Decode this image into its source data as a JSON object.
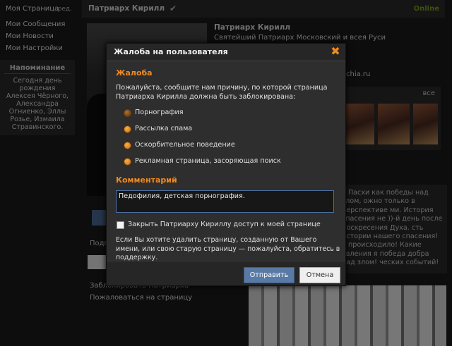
{
  "sidebar": {
    "items": [
      {
        "label": "Моя Страница",
        "edit": "ред."
      },
      {
        "label": "Мои Сообщения"
      },
      {
        "label": "Мои Новости"
      },
      {
        "label": "Мои Настройки"
      }
    ],
    "reminder": {
      "title": "Напоминание",
      "text": "Сегодня день рождения Алексея Чёрного, Александра Огниенко, Эллы Розье, Измаила Стравинского."
    }
  },
  "header": {
    "name": "Патриарх Кирилл",
    "status": "Online"
  },
  "profile": {
    "name": "Патриарх Кирилл",
    "title": "Святейший Патриарх Московский и всея Руси",
    "site_fragment": "chia.ru",
    "photos_all": "все",
    "post_text": "е Пасхи как победы над злом, ожно только в перспективе ми. История спасения не ))-й день после Воскресения Духа. сть истории нашего спасения! е происходило! Какие явления я победа добра над злом! ческих событий!",
    "under_text": "Подп",
    "link_block": "Заблокировать Патриарха",
    "link_report": "Пожаловаться на страницу"
  },
  "modal": {
    "title": "Жалоба на пользователя",
    "section_reason": "Жалоба",
    "prompt": "Пожалуйста, сообщите нам причину, по которой страница Патриарха Кирилла должна быть заблокирована:",
    "options": [
      "Порнография",
      "Рассылка спама",
      "Оскорбительное поведение",
      "Рекламная страница, засоряющая поиск"
    ],
    "selected_option": 0,
    "section_comment": "Комментарий",
    "comment_value": "Педофилия, детская порнография.",
    "checkbox_label": "Закрыть Патриарху Кириллу доступ к моей странице",
    "checkbox_checked": false,
    "note": "Если Вы хотите удалить страницу, созданную от Вашего имени, или свою старую страницу — пожалуйста, обратитесь в поддержку.",
    "send_label": "Отправить",
    "cancel_label": "Отмена"
  },
  "colors": {
    "accent": "#f08a1e",
    "online": "#7ea21c",
    "primary_button": "#5a7aa6"
  }
}
